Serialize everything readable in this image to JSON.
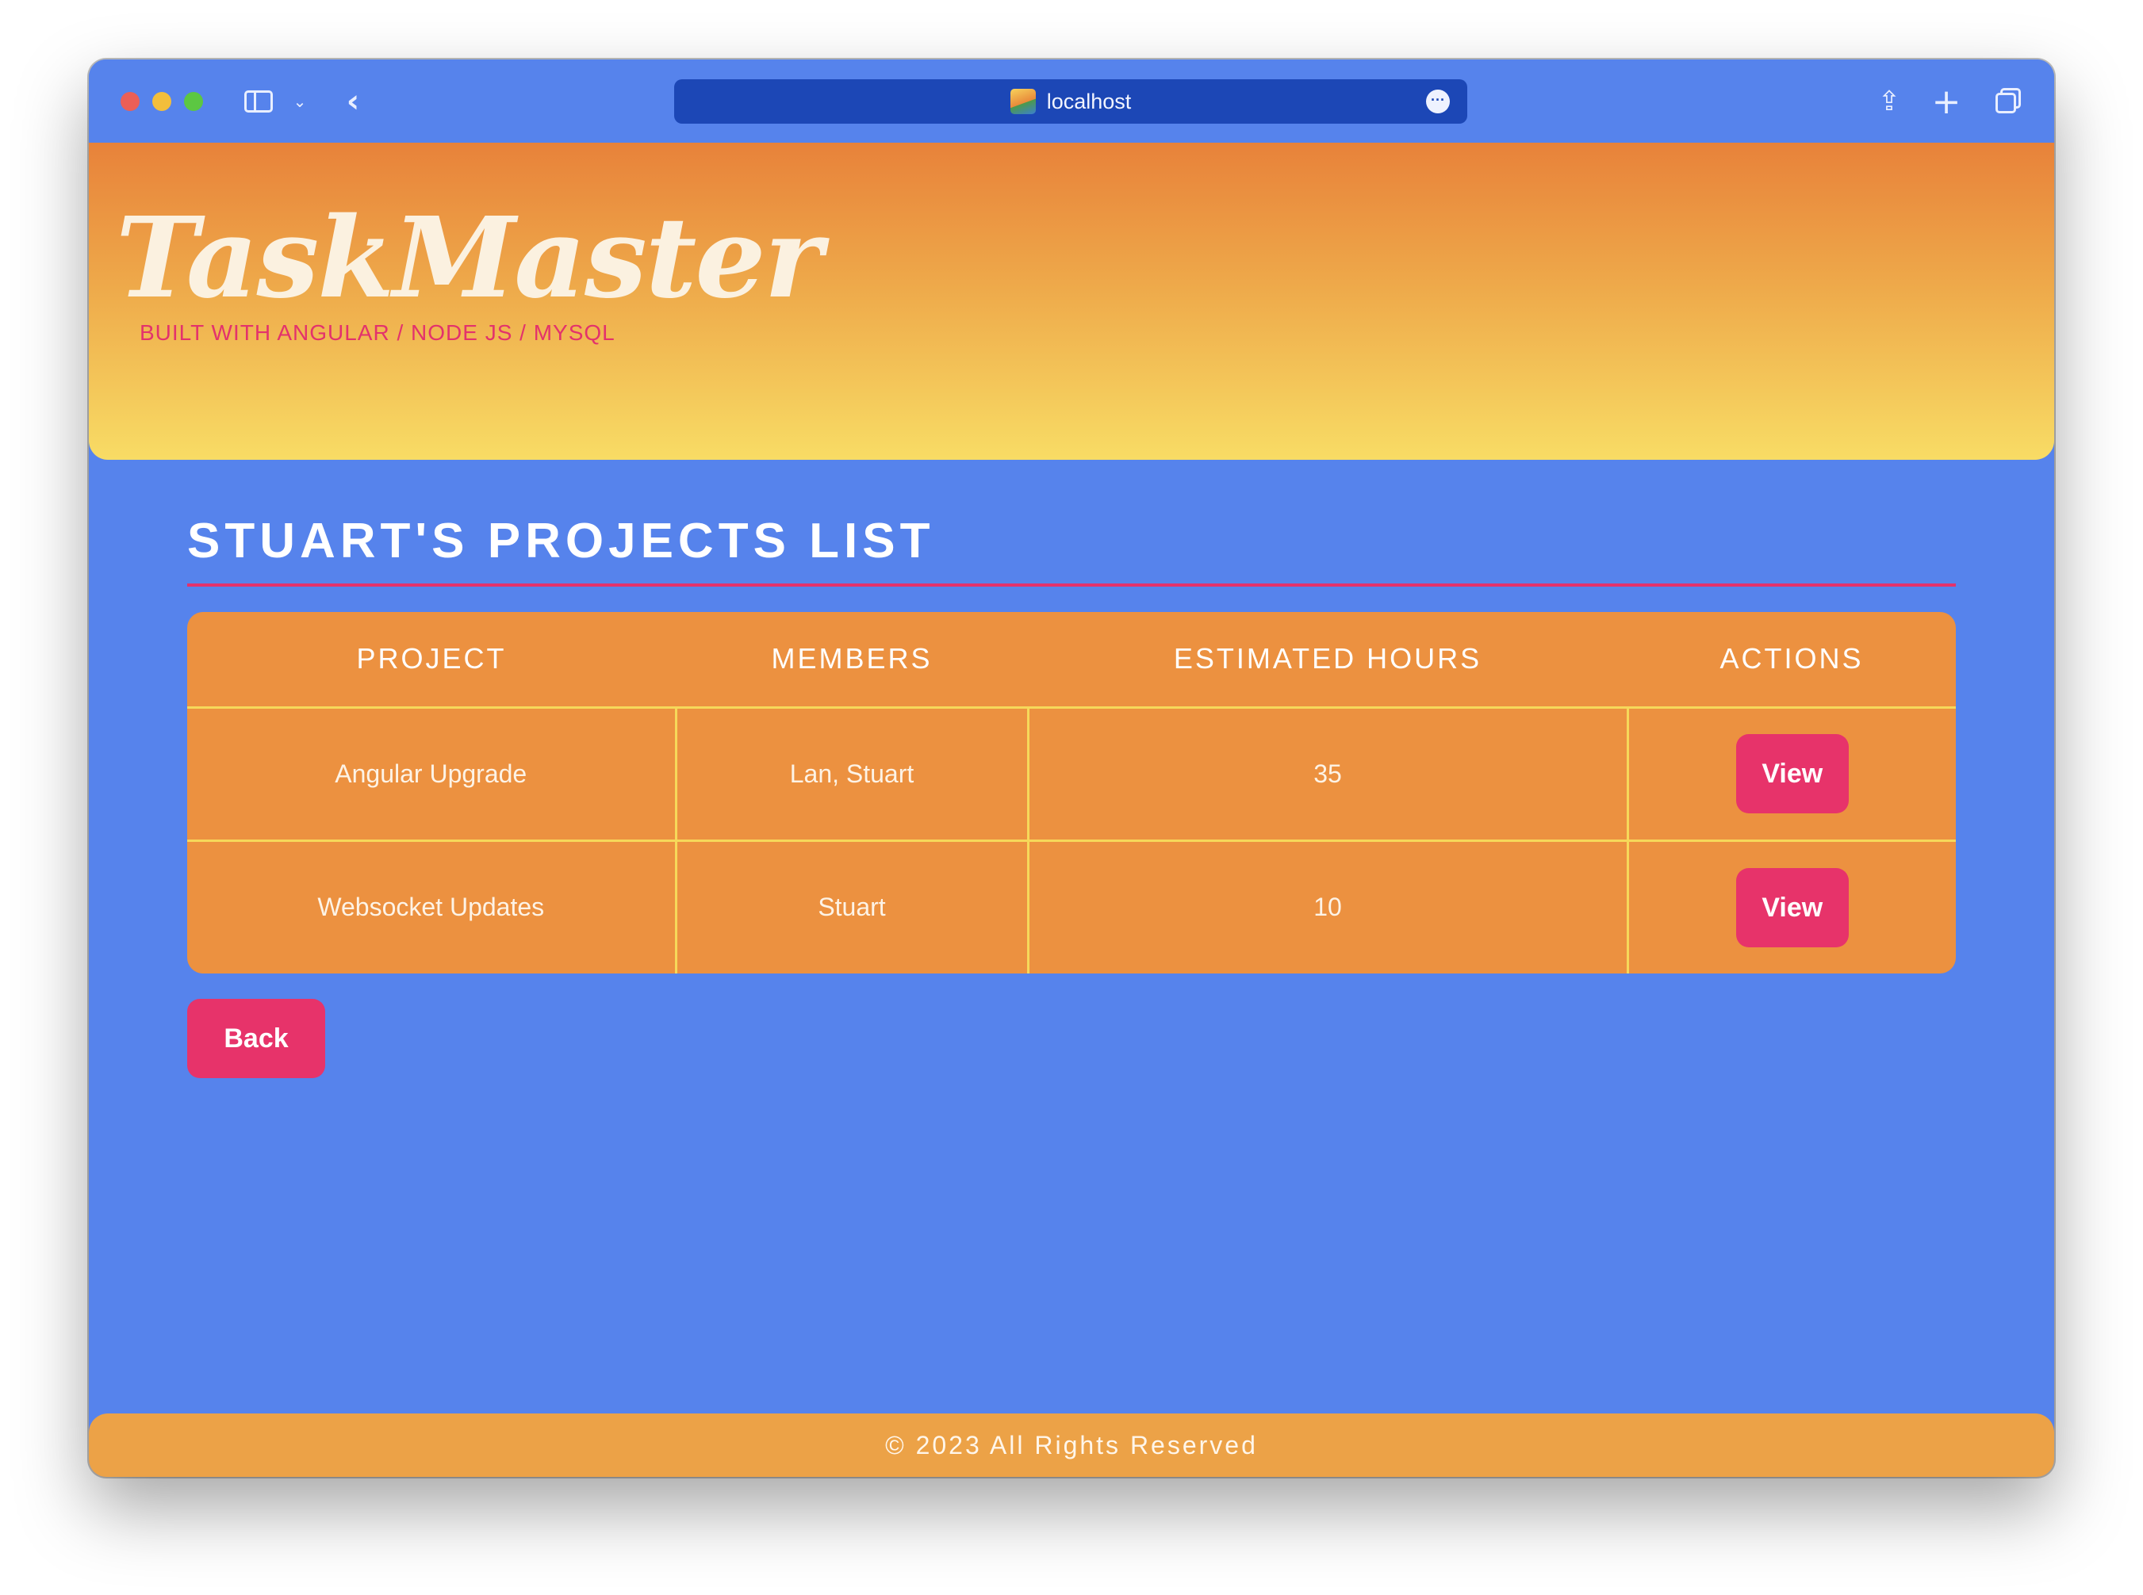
{
  "browser": {
    "url": "localhost",
    "icons": {
      "sidebar": "sidebar-icon",
      "chevron": "chevron-down-icon",
      "back": "chevron-left-icon",
      "more": "ellipsis-icon",
      "share": "share-icon",
      "new_tab": "plus-icon",
      "tabs": "tabs-overview-icon"
    }
  },
  "header": {
    "logo": "TaskMaster",
    "tagline": "BUILT WITH ANGULAR / NODE JS / MYSQL"
  },
  "main": {
    "title": "STUART'S PROJECTS LIST",
    "table": {
      "columns": [
        "PROJECT",
        "MEMBERS",
        "ESTIMATED HOURS",
        "ACTIONS"
      ],
      "rows": [
        {
          "project": "Angular Upgrade",
          "members": "Lan, Stuart",
          "hours": "35",
          "action": "View"
        },
        {
          "project": "Websocket Updates",
          "members": "Stuart",
          "hours": "10",
          "action": "View"
        }
      ]
    },
    "back_label": "Back"
  },
  "footer": {
    "text": "© 2023 All Rights Reserved"
  },
  "colors": {
    "page_bg": "#5683ec",
    "accent": "#e7336a",
    "table_bg": "#ec9140",
    "table_lines": "#f6d85a"
  }
}
